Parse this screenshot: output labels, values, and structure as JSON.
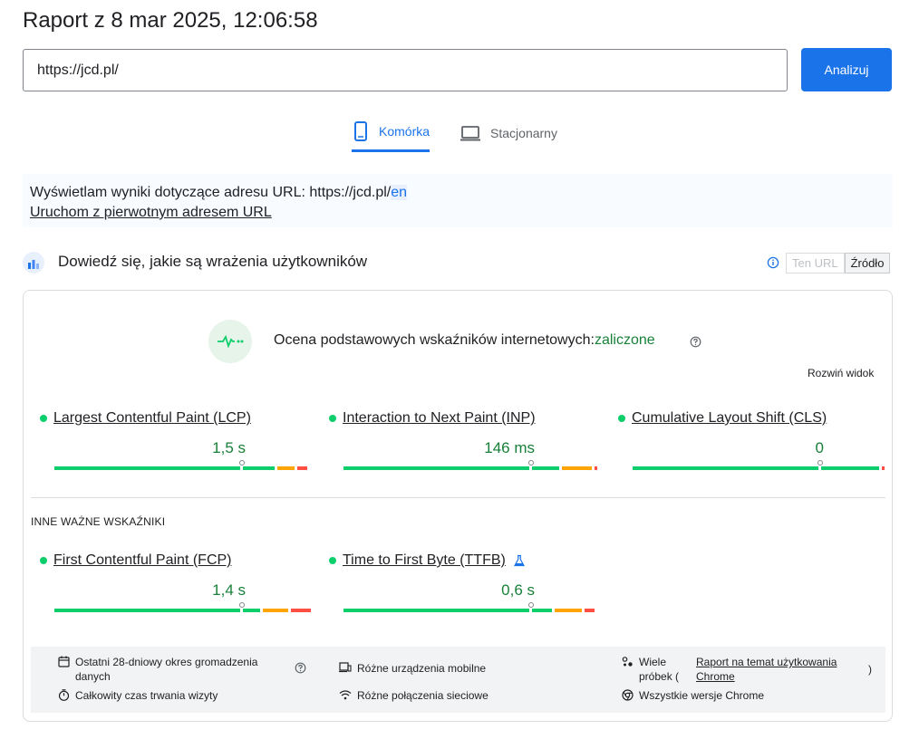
{
  "header": {
    "title": "Raport z 8 mar 2025, 12:06:58"
  },
  "search": {
    "url_value": "https://jcd.pl/",
    "analyze_label": "Analizuj"
  },
  "tabs": [
    {
      "label": "Komórka",
      "icon": "mobile-phone-icon",
      "active": true
    },
    {
      "label": "Stacjonarny",
      "icon": "laptop-icon",
      "active": false
    }
  ],
  "notice": {
    "prefix": "Wyświetlam wyniki dotyczące adresu URL: https://jcd.pl/",
    "highlight": "en",
    "link": "Uruchom z pierwotnym adresem URL"
  },
  "crux": {
    "title": "Dowiedź się, jakie są wrażenia użytkowników",
    "toggle": {
      "url_label": "Ten URL",
      "origin_label": "Źródło",
      "selected": "Źródło"
    }
  },
  "cwv": {
    "label": "Ocena podstawowych wskaźników internetowych:",
    "status": "zaliczone",
    "expand_label": "Rozwiń widok"
  },
  "metrics": [
    {
      "name": "Largest Contentful Paint (LCP)",
      "value": "1,5 s",
      "dist": [
        0.74,
        0.125,
        0.07,
        0.04
      ]
    },
    {
      "name": "Interaction to Next Paint (INP)",
      "value": "146 ms",
      "dist": [
        0.74,
        0.11,
        0.12,
        0.01
      ]
    },
    {
      "name": "Cumulative Layout Shift (CLS)",
      "value": "0",
      "dist": [
        0.74,
        0.23,
        0.0,
        0.01
      ]
    }
  ],
  "other": {
    "label": "INNE WAŻNE WSKAŹNIKI",
    "metrics": [
      {
        "name": "First Contentful Paint (FCP)",
        "value": "1,4 s",
        "dist": [
          0.74,
          0.07,
          0.1,
          0.08
        ],
        "lab": false
      },
      {
        "name": "Time to First Byte (TTFB)",
        "value": "0,6 s",
        "dist": [
          0.74,
          0.08,
          0.11,
          0.04
        ],
        "lab": true
      }
    ]
  },
  "footer": {
    "period": "Ostatni 28-dniowy okres gromadzenia danych",
    "duration": "Całkowity czas trwania wizyty",
    "devices": "Różne urządzenia mobilne",
    "connections": "Różne połączenia sieciowe",
    "samples_prefix": "Wiele próbek (",
    "samples_link": "Raport na temat użytkowania Chrome",
    "samples_suffix": ")",
    "versions": "Wszystkie wersje Chrome"
  },
  "colors": {
    "accent": "#1a73e8",
    "good": "#0cce6b",
    "average": "#ffa400",
    "poor": "#ff4e42",
    "pass_text": "#188038"
  }
}
